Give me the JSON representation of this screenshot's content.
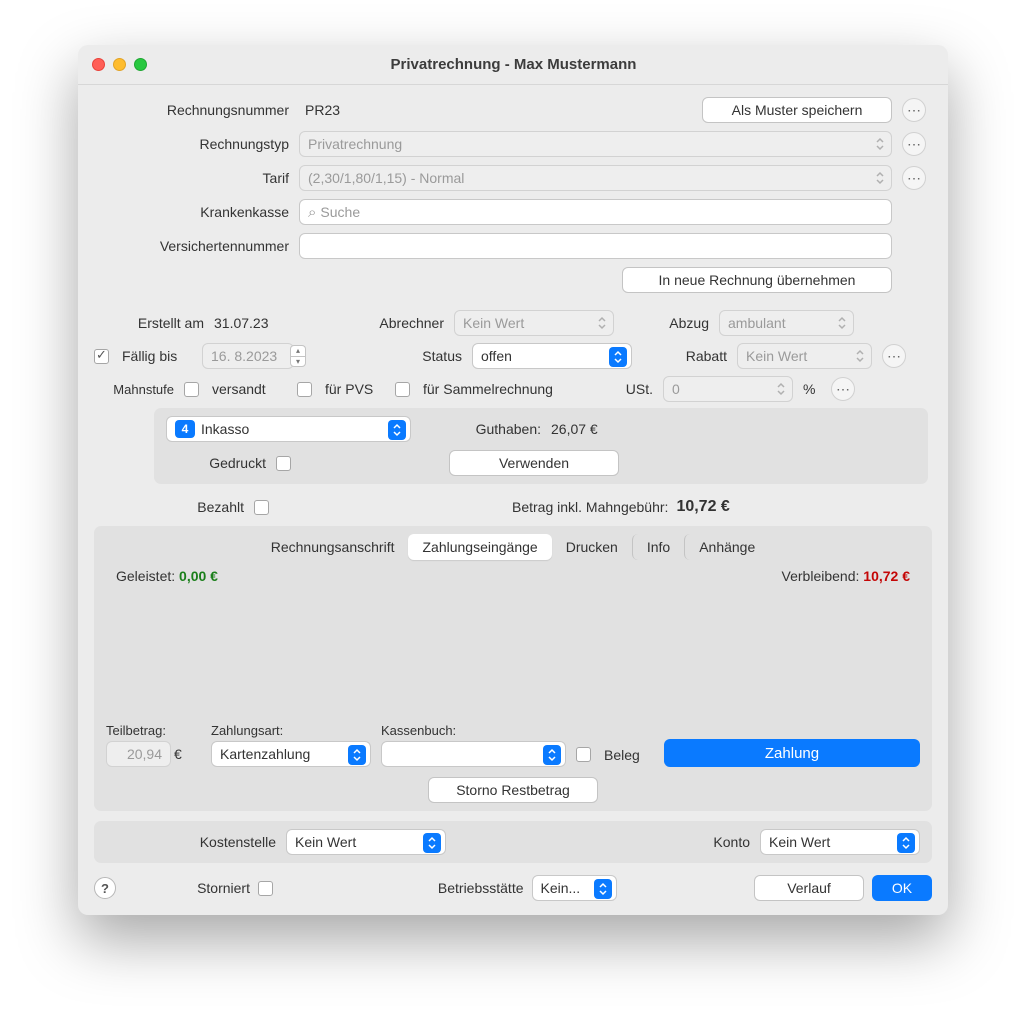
{
  "window": {
    "title": "Privatrechnung - Max Mustermann"
  },
  "header": {
    "rechnungsnummer_label": "Rechnungsnummer",
    "rechnungsnummer_value": "PR23",
    "als_muster_btn": "Als Muster speichern",
    "rechnungstyp_label": "Rechnungstyp",
    "rechnungstyp_value": "Privatrechnung",
    "tarif_label": "Tarif",
    "tarif_value": "(2,30/1,80/1,15) - Normal",
    "krankenkasse_label": "Krankenkasse",
    "krankenkasse_placeholder": "Suche",
    "versichertennr_label": "Versichertennummer",
    "versichertennr_value": "",
    "neue_rechnung_btn": "In neue Rechnung übernehmen"
  },
  "meta": {
    "erstellt_label": "Erstellt am",
    "erstellt_value": "31.07.23",
    "abrechner_label": "Abrechner",
    "abrechner_value": "Kein Wert",
    "abzug_label": "Abzug",
    "abzug_value": "ambulant",
    "fallig_label": "Fällig bis",
    "fallig_value": "16.  8.2023",
    "status_label": "Status",
    "status_value": "offen",
    "rabatt_label": "Rabatt",
    "rabatt_value": "Kein Wert",
    "mahnstufe_label": "Mahnstufe",
    "versandt_label": "versandt",
    "fur_pvs_label": "für PVS",
    "sammelrechnung_label": "für Sammelrechnung",
    "ust_label": "USt.",
    "ust_value": "0",
    "ust_pct": "%"
  },
  "inkasso": {
    "badge": "4",
    "inkasso_value": "Inkasso",
    "guthaben_label": "Guthaben:",
    "guthaben_value": "26,07 €",
    "gedruckt_label": "Gedruckt",
    "verwenden_btn": "Verwenden"
  },
  "bezahlt": {
    "bezahlt_label": "Bezahlt",
    "betrag_label": "Betrag inkl. Mahngebühr:",
    "betrag_value": "10,72 €"
  },
  "tabs": {
    "t0": "Rechnungsanschrift",
    "t1": "Zahlungseingänge",
    "t2": "Drucken",
    "t3": "Info",
    "t4": "Anhänge"
  },
  "payments": {
    "geleistet_label": "Geleistet:",
    "geleistet_value": "0,00 €",
    "verbleibend_label": "Verbleibend:",
    "verbleibend_value": "10,72 €",
    "teilbetrag_label": "Teilbetrag:",
    "teilbetrag_value": "20,94",
    "teilbetrag_cur": "€",
    "zahlungsart_label": "Zahlungsart:",
    "zahlungsart_value": "Kartenzahlung",
    "kassenbuch_label": "Kassenbuch:",
    "kassenbuch_value": "",
    "beleg_label": "Beleg",
    "zahlung_btn": "Zahlung",
    "storno_btn": "Storno Restbetrag"
  },
  "footer": {
    "kostenstelle_label": "Kostenstelle",
    "kostenstelle_value": "Kein Wert",
    "konto_label": "Konto",
    "konto_value": "Kein Wert",
    "storniert_label": "Storniert",
    "betriebsst_label": "Betriebsstätte",
    "betriebsst_value": "Kein...",
    "verlauf_btn": "Verlauf",
    "ok_btn": "OK",
    "help": "?"
  }
}
